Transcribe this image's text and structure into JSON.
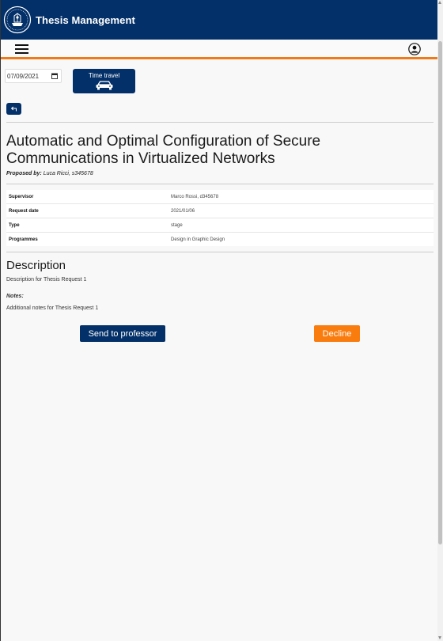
{
  "header": {
    "app_title": "Thesis Management"
  },
  "time_travel": {
    "date_value": "07/09/2021",
    "button_label": "Time travel"
  },
  "thesis": {
    "title": "Automatic and Optimal Configuration of Secure Communications in Virtualized Networks",
    "proposed_by_label": "Proposed by:",
    "proposed_by_value": "Luca Ricci, s345678",
    "details": [
      {
        "label": "Supervisor",
        "value": "Marco Rossi, d345678"
      },
      {
        "label": "Request date",
        "value": "2021/01/06"
      },
      {
        "label": "Type",
        "value": "stage"
      },
      {
        "label": "Programmes",
        "value": "Design in Graphic Design"
      }
    ],
    "description_heading": "Description",
    "description_text": "Description for Thesis Request 1",
    "notes_label": "Notes:",
    "notes_text": "Additional notes for Thesis Request 1"
  },
  "actions": {
    "send_label": "Send to professor",
    "decline_label": "Decline"
  },
  "colors": {
    "primary": "#033068",
    "accent": "#f97c0e"
  },
  "icons": [
    "university-logo-icon",
    "menu-icon",
    "user-icon",
    "calendar-icon",
    "car-icon",
    "back-arrow-icon"
  ]
}
